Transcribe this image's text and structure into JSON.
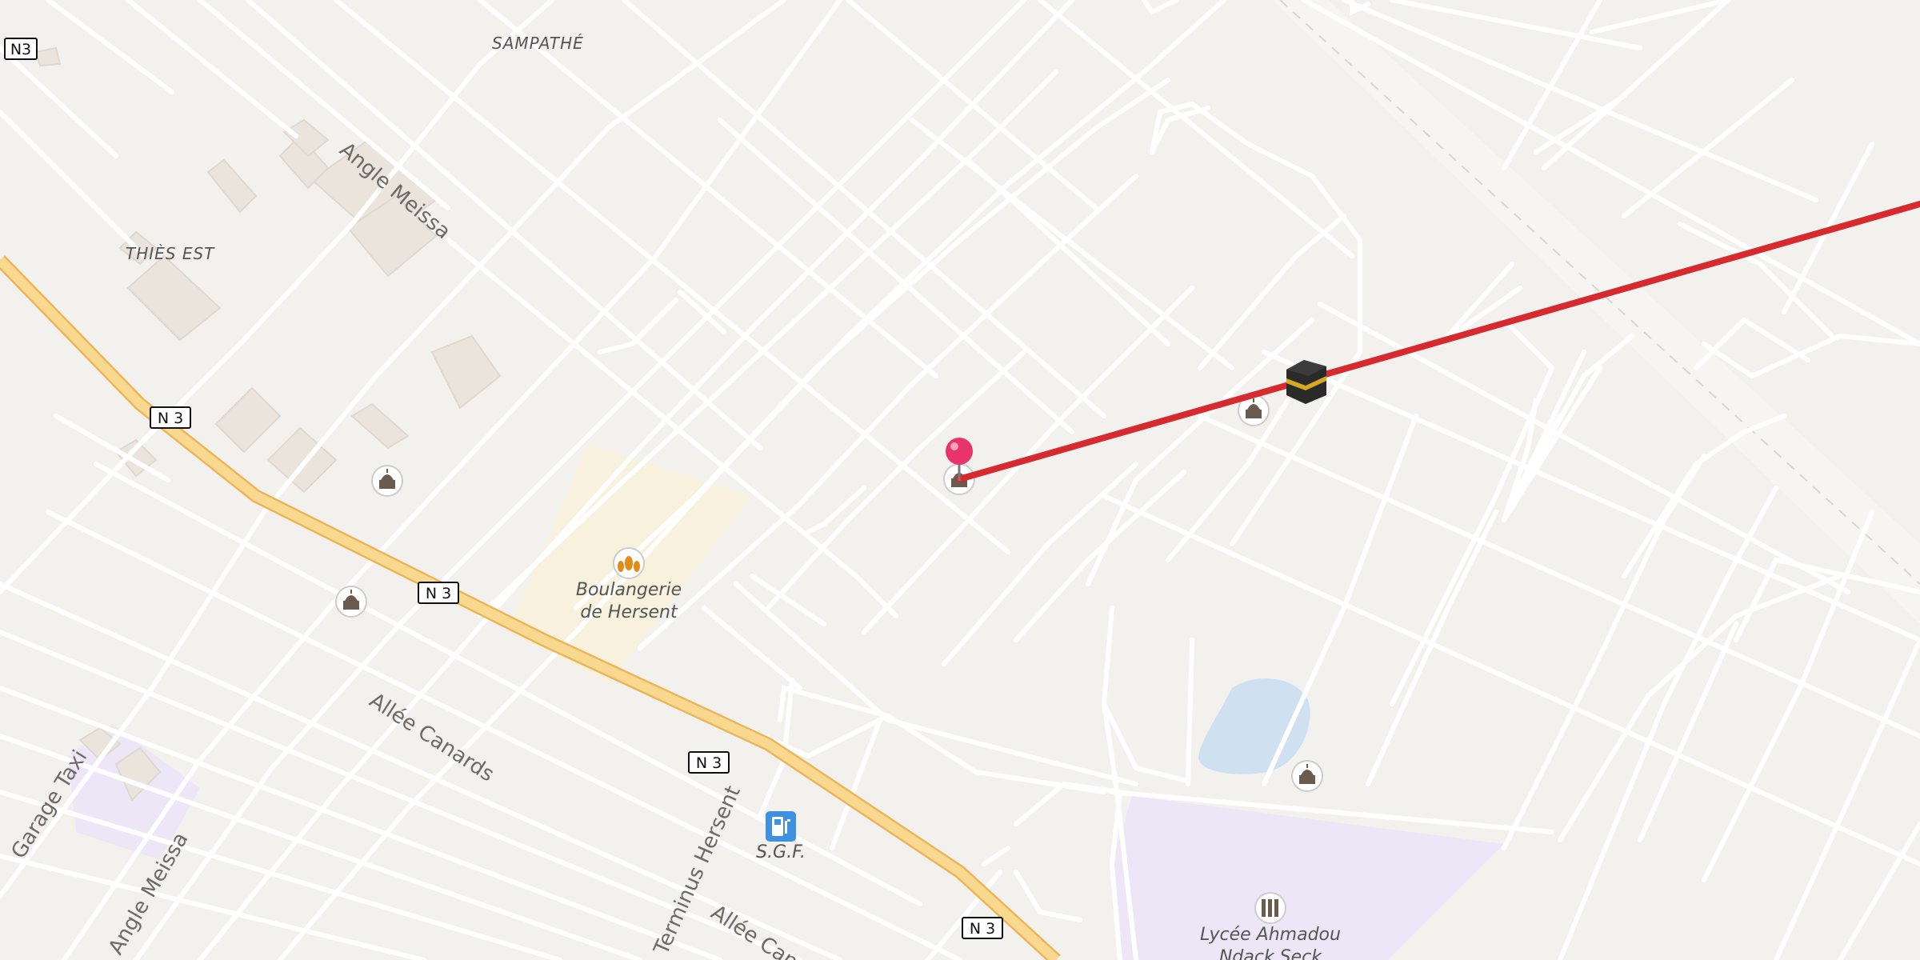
{
  "map": {
    "colors": {
      "background": "#f3f1ee",
      "road": "#ffffff",
      "primary_road": "#f9d98f",
      "route_line": "#d62a2f",
      "pin": "#e8336b",
      "water": "#cfe0f0",
      "school_area": "#ece6f6",
      "bakery_area": "#f8f1de"
    },
    "place_labels": [
      "SAMPATHÉ",
      "THIÈS EST"
    ],
    "road_shields": [
      "N3",
      "N 3",
      "N 3",
      "N 3",
      "N 3"
    ],
    "street_labels": [
      "Angle Meissa",
      "Allée Canards",
      "Terminus Hersent",
      "Allée Canards",
      "Garage Taxi",
      "Angle Meissa"
    ],
    "pois": [
      {
        "name_line1": "Boulangerie",
        "name_line2": "de Hersent",
        "icon": "bakery-icon"
      },
      {
        "name": "S.G.F.",
        "icon": "fuel-station-icon"
      },
      {
        "name_line1": "Lycée Ahmadou",
        "name_line2": "Ndack Seck",
        "icon": "school-icon"
      }
    ],
    "mosque_icons": [
      "mosque-icon",
      "mosque-icon",
      "mosque-icon",
      "mosque-icon",
      "mosque-icon"
    ],
    "markers": {
      "location_pin": "location-pin-icon",
      "kaaba": "kaaba-icon"
    }
  }
}
